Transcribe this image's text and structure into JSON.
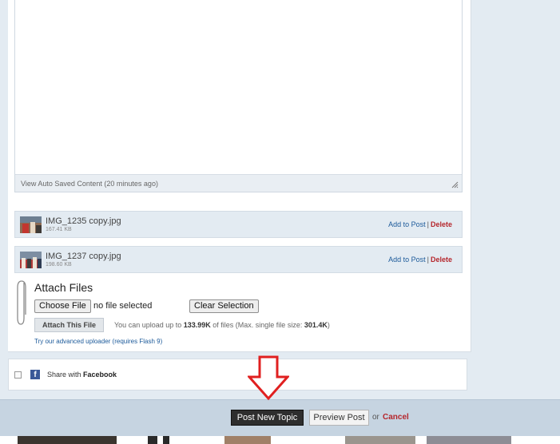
{
  "editor": {
    "autosave_link": "View Auto Saved Content (20 minutes ago)"
  },
  "attachments": [
    {
      "name": "IMG_1235 copy.jpg",
      "size": "167.41 KB",
      "add_label": "Add to Post",
      "sep": "|",
      "delete_label": "Delete"
    },
    {
      "name": "IMG_1237 copy.jpg",
      "size": "198.60 KB",
      "add_label": "Add to Post",
      "sep": "|",
      "delete_label": "Delete"
    }
  ],
  "attach_files": {
    "title": "Attach Files",
    "choose_file_label": "Choose File",
    "no_file_text": "no file selected",
    "clear_selection_label": "Clear Selection",
    "attach_button_label": "Attach This File",
    "upload_prefix": "You can upload up to ",
    "upload_amount": "133.99K",
    "upload_mid": " of files (Max. single file size: ",
    "upload_max": "301.4K",
    "upload_suffix": ")",
    "flash_link": "Try our advanced uploader (requires Flash 9)"
  },
  "share": {
    "prefix": "Share with ",
    "network": "Facebook",
    "icon": "facebook-icon"
  },
  "footer": {
    "post_button": "Post New Topic",
    "preview_button": "Preview Post",
    "or_text": "or",
    "cancel_link": "Cancel"
  },
  "colors": {
    "page_bg": "#e3ebf2",
    "link": "#1c5a9a",
    "delete": "#b5262c",
    "arrow": "#e02020",
    "facebook": "#3b5998",
    "post_button_bg": "#2e2e2e"
  }
}
